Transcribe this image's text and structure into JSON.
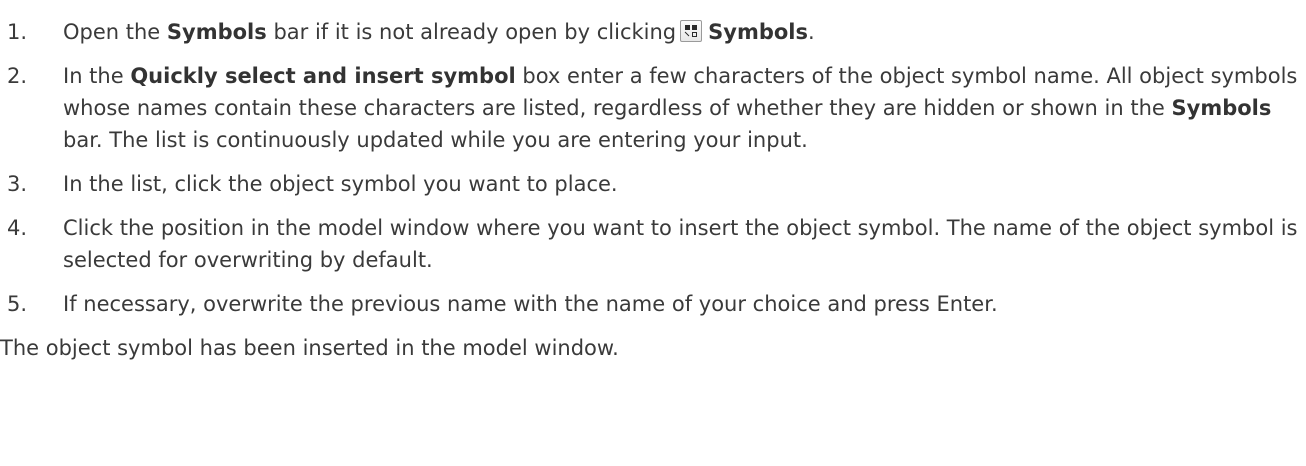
{
  "steps": [
    {
      "num": "1.",
      "t1": "Open the ",
      "b1": "Symbols",
      "t2": " bar if it is not already open by clicking",
      "icon": "symbols-icon",
      "b2": "Symbols",
      "t3": "."
    },
    {
      "num": "2.",
      "t1": "In the ",
      "b1": "Quickly select and insert symbol",
      "t2": " box enter a few characters of the object symbol name. All object symbols whose names contain these characters are listed, regardless of whether they are hidden or shown in the ",
      "b2": "Symbols",
      "t3": " bar. The list is continuously updated while you are entering your input."
    },
    {
      "num": "3.",
      "text": "In the list, click the object symbol you want to place."
    },
    {
      "num": "4.",
      "text": "Click the position in the model window where you want to insert the object symbol. The name of the object symbol is selected for overwriting by default."
    },
    {
      "num": "5.",
      "text": "If necessary, overwrite the previous name with the name of your choice and press Enter."
    }
  ],
  "result": "The object symbol has been inserted in the model window."
}
